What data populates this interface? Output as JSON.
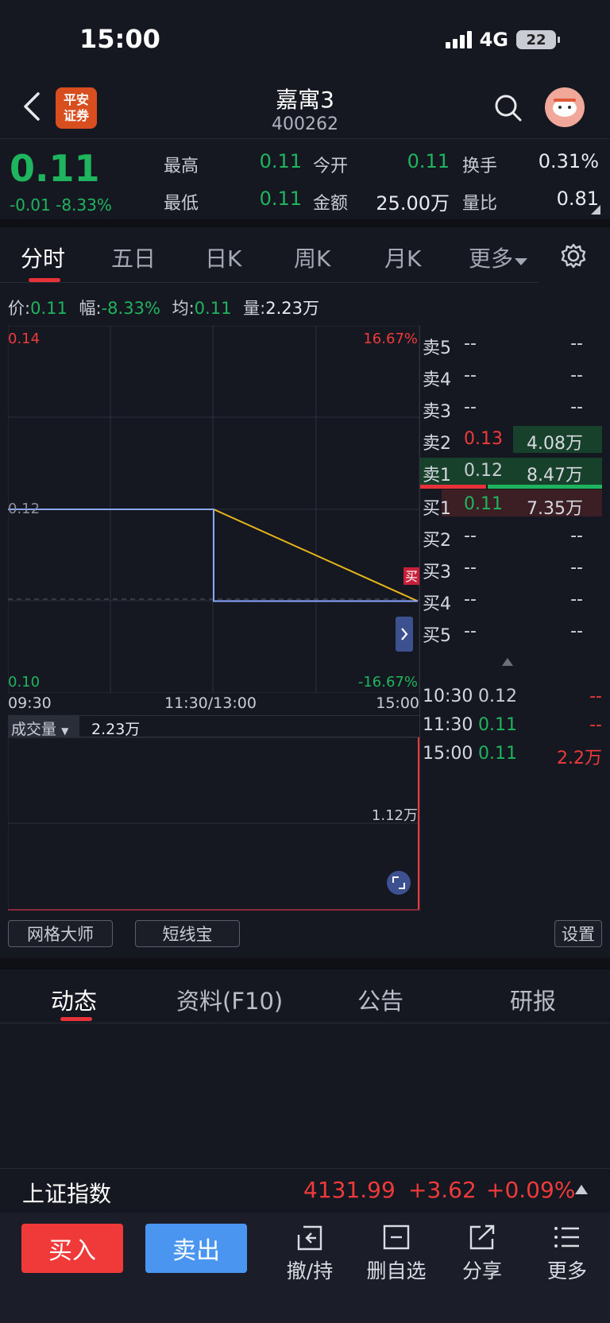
{
  "status": {
    "time": "15:00",
    "network": "4G",
    "battery": "22"
  },
  "nav": {
    "logo_line1": "平安",
    "logo_line2": "证券",
    "stock_name": "嘉寓3",
    "stock_code": "400262"
  },
  "quote": {
    "price": "0.11",
    "change": "-0.01",
    "change_pct": "-8.33%",
    "high_label": "最高",
    "high": "0.11",
    "low_label": "最低",
    "low": "0.11",
    "open_label": "今开",
    "open": "0.11",
    "amount_label": "金额",
    "amount": "25.00万",
    "turnover_label": "换手",
    "turnover": "0.31%",
    "volratio_label": "量比",
    "volratio": "0.81"
  },
  "tabs": [
    {
      "label": "分时",
      "active": true
    },
    {
      "label": "五日"
    },
    {
      "label": "日K"
    },
    {
      "label": "周K"
    },
    {
      "label": "月K"
    },
    {
      "label": "更多"
    }
  ],
  "info_row": {
    "price_label": "价:",
    "price": "0.11",
    "amp_label": "幅:",
    "amp": "-8.33%",
    "avg_label": "均:",
    "avg": "0.11",
    "vol_label": "量:",
    "vol": "2.23万"
  },
  "chart": {
    "y_top": "0.14",
    "y_mid": "0.12",
    "y_bottom": "0.10",
    "pct_top": "16.67%",
    "pct_bottom": "-16.67%",
    "x_start": "09:30",
    "x_mid": "11:30/13:00",
    "x_end": "15:00",
    "buy_marker": "买",
    "volume_label": "成交量",
    "volume_value": "2.23万",
    "volume_mid": "1.12万"
  },
  "chart_data": {
    "type": "line",
    "x": [
      "09:30",
      "11:30",
      "11:30",
      "15:00"
    ],
    "series": [
      {
        "values": [
          0.12,
          0.12,
          0.11,
          0.11
        ],
        "color": "#8aa8ff"
      },
      {
        "values": [
          0.12,
          0.12,
          0.12,
          0.11
        ],
        "color": "#e8b51a"
      }
    ],
    "ylim": [
      0.1,
      0.14
    ],
    "prev_close": 0.12
  },
  "order_book": {
    "asks": [
      {
        "label": "卖5",
        "price": "--",
        "vol": "--"
      },
      {
        "label": "卖4",
        "price": "--",
        "vol": "--"
      },
      {
        "label": "卖3",
        "price": "--",
        "vol": "--"
      },
      {
        "label": "卖2",
        "price": "0.13",
        "vol": "4.08万"
      },
      {
        "label": "卖1",
        "price": "0.12",
        "vol": "8.47万"
      }
    ],
    "bids": [
      {
        "label": "买1",
        "price": "0.11",
        "vol": "7.35万"
      },
      {
        "label": "买2",
        "price": "--",
        "vol": "--"
      },
      {
        "label": "买3",
        "price": "--",
        "vol": "--"
      },
      {
        "label": "买4",
        "price": "--",
        "vol": "--"
      },
      {
        "label": "买5",
        "price": "--",
        "vol": "--"
      }
    ]
  },
  "trades": [
    {
      "time": "10:30",
      "price": "0.12",
      "vol": "--"
    },
    {
      "time": "11:30",
      "price": "0.11",
      "vol": "--"
    },
    {
      "time": "15:00",
      "price": "0.11",
      "vol": "2.2万"
    }
  ],
  "tools": {
    "grid": "网格大师",
    "short": "短线宝",
    "settings": "设置"
  },
  "bottom_tabs": [
    {
      "label": "动态",
      "active": true
    },
    {
      "label": "资料(F10)"
    },
    {
      "label": "公告"
    },
    {
      "label": "研报"
    }
  ],
  "index": {
    "name": "上证指数",
    "value": "4131.99",
    "change": "+3.62",
    "pct": "+0.09%"
  },
  "trade_bar": {
    "buy": "买入",
    "sell": "卖出",
    "cancel": "撤/持",
    "remove": "删自选",
    "share": "分享",
    "more": "更多"
  },
  "colors": {
    "up": "#f03a3a",
    "down": "#1fb45e",
    "price_line": "#8aa8ff",
    "avg_line": "#e8b51a",
    "buy_btn": "#f03a3a",
    "sell_btn": "#4a95f0"
  }
}
